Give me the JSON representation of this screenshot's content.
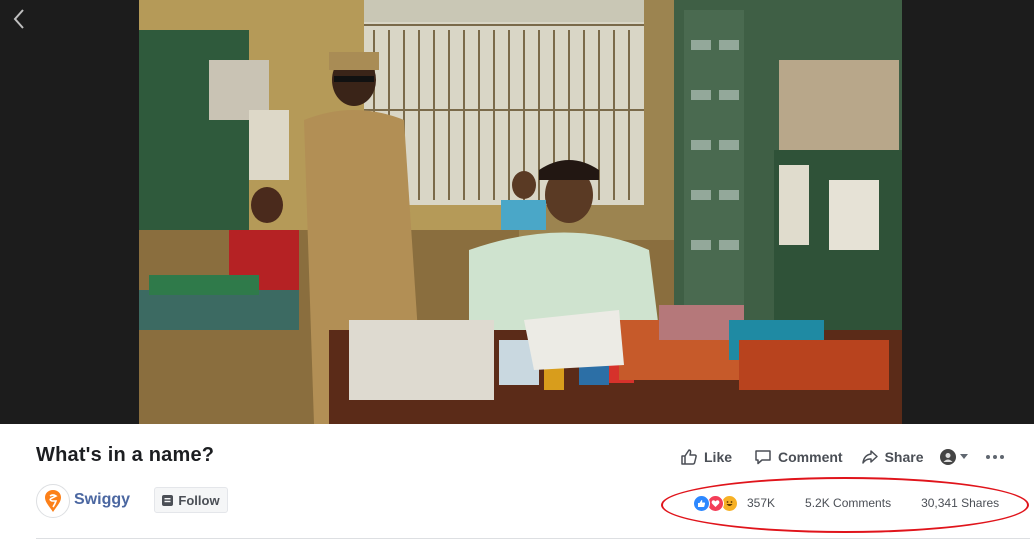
{
  "post": {
    "title": "What's in a name?"
  },
  "actions": {
    "like_label": "Like",
    "comment_label": "Comment",
    "share_label": "Share"
  },
  "page": {
    "name": "Swiggy",
    "follow_label": "Follow"
  },
  "stats": {
    "reactions_count": "357K",
    "comments": "5.2K Comments",
    "shares": "30,341 Shares",
    "reaction_types": [
      "like",
      "love",
      "haha"
    ]
  },
  "colors": {
    "link": "#4b67a1",
    "highlight": "#e0141b",
    "brand": "#fc8019"
  },
  "icons": {
    "back": "chevron-left-icon",
    "like": "thumbs-up-icon",
    "comment": "speech-bubble-icon",
    "share": "share-arrow-icon",
    "more": "ellipsis-icon"
  }
}
